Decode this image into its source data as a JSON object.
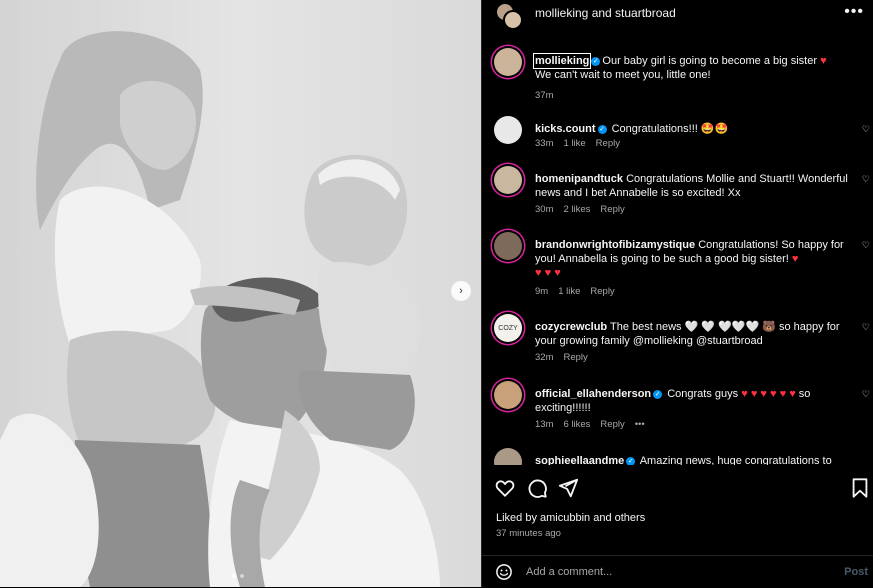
{
  "header": {
    "title": "mollieking and stuartbroad"
  },
  "caption": {
    "username": "mollieking",
    "text": "Our baby girl is going to become a big sister",
    "text2": "We can't wait to meet you, little one!",
    "time": "37m"
  },
  "comments": [
    {
      "username": "kicks.count",
      "text": "Congratulations!!! 🤩🤩",
      "time": "33m",
      "likes": "1 like",
      "reply": "Reply"
    },
    {
      "username": "homenipandtuck",
      "text": "Congratulations Mollie and Stuart!! Wonderful news and I bet Annabelle is so excited! Xx",
      "time": "30m",
      "likes": "2 likes",
      "reply": "Reply"
    },
    {
      "username": "brandonwrightofibizamystique",
      "text": "Congratulations! So happy for you! Annabella is going to be such a good big sister!",
      "time": "9m",
      "likes": "1 like",
      "reply": "Reply"
    },
    {
      "username": "cozycrewclub",
      "text": "The best news 🤍 🤍 🤍🤍🤍 🐻 so happy for your growing family @mollieking @stuartbroad",
      "time": "32m",
      "reply": "Reply",
      "avatar_text": "COZY"
    },
    {
      "username": "official_ellahenderson",
      "text": "Congrats guys",
      "text_after": "so exciting!!!!!!",
      "time": "13m",
      "likes": "6 likes",
      "reply": "Reply",
      "more": "•••"
    },
    {
      "username": "sophieellaandme",
      "text": "Amazing news, huge congratulations to"
    }
  ],
  "footer": {
    "liked_by": "Liked by amicubbin and others",
    "posted": "37 minutes ago",
    "add_comment_placeholder": "Add a comment...",
    "post_label": "Post"
  },
  "icons": {
    "more": "•••",
    "next": "›",
    "heart_red": "♥",
    "heart_small": "♡",
    "verified": "✓"
  }
}
